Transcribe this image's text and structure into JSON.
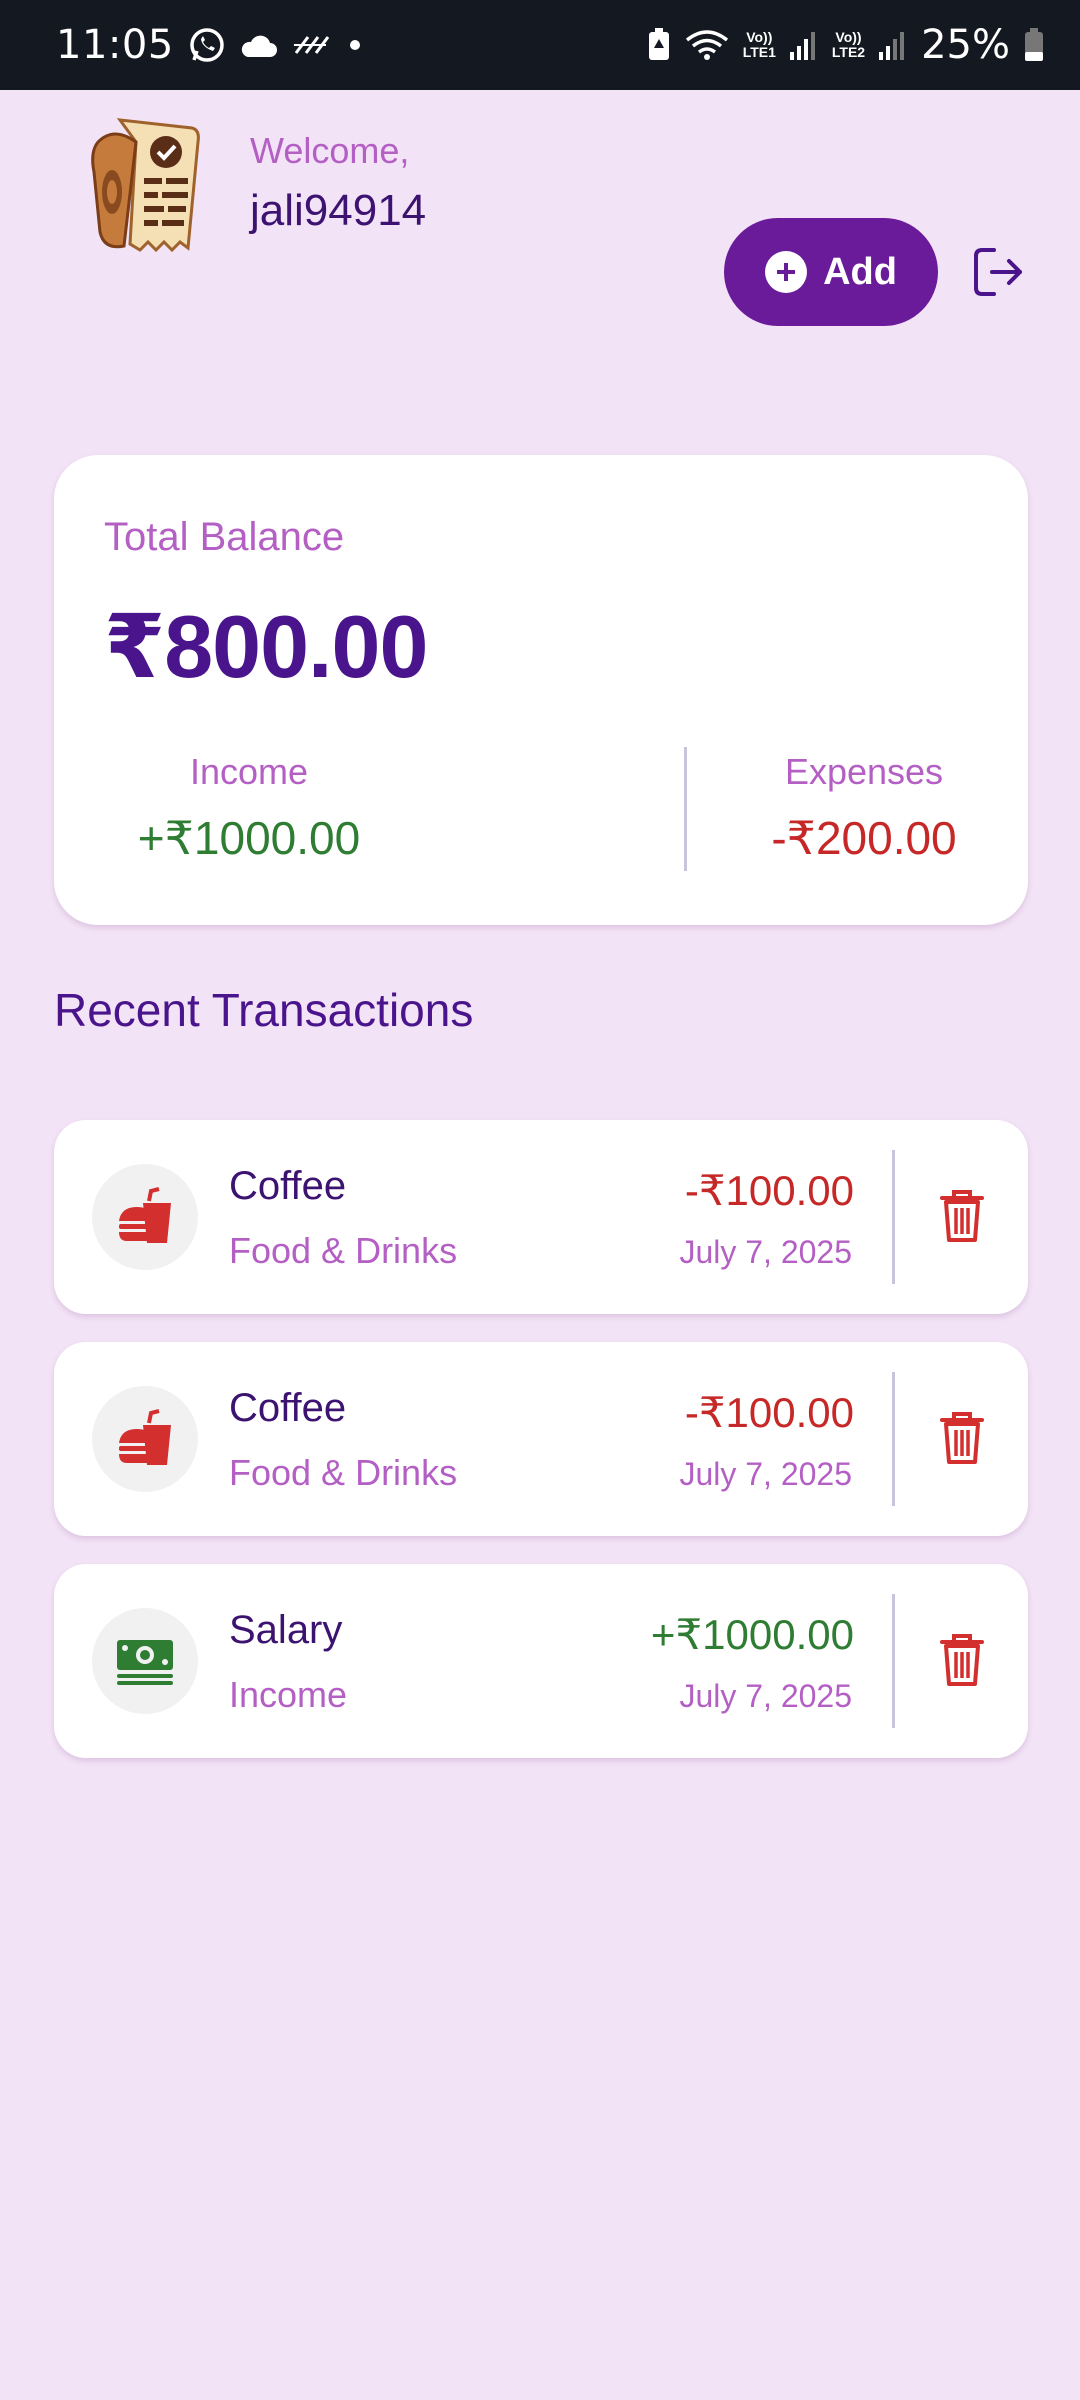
{
  "status_bar": {
    "time": "11:05",
    "battery_percent": "25%",
    "sim1_top": "Vo))",
    "sim1_bottom": "LTE1",
    "sim2_top": "Vo))",
    "sim2_bottom": "LTE2",
    "icons": [
      "whatsapp-icon",
      "cloud-icon",
      "signal-hash-icon",
      "dot-icon",
      "battery-saver-icon",
      "wifi-icon",
      "cell-signal-icon",
      "cell-signal-icon",
      "battery-icon"
    ]
  },
  "header": {
    "welcome": "Welcome,",
    "username": "jali94914",
    "add_label": "Add",
    "logo_icon": "receipt-logo-icon",
    "logout_icon": "logout-icon"
  },
  "balance": {
    "label": "Total Balance",
    "amount": "₹800.00",
    "income_label": "Income",
    "income_amount": "+₹1000.00",
    "expenses_label": "Expenses",
    "expenses_amount": "-₹200.00"
  },
  "section": {
    "title": "Recent Transactions"
  },
  "transactions": [
    {
      "title": "Coffee",
      "category": "Food & Drinks",
      "amount": "-₹100.00",
      "date": "July 7, 2025",
      "type": "expense",
      "icon": "food-drink-icon"
    },
    {
      "title": "Coffee",
      "category": "Food & Drinks",
      "amount": "-₹100.00",
      "date": "July 7, 2025",
      "type": "expense",
      "icon": "food-drink-icon"
    },
    {
      "title": "Salary",
      "category": "Income",
      "amount": "+₹1000.00",
      "date": "July 7, 2025",
      "type": "income",
      "icon": "money-icon"
    }
  ],
  "colors": {
    "background": "#f3e3f6",
    "primary": "#6a1b9a",
    "heading": "#4a148c",
    "accent_text": "#b45fc4",
    "income": "#2e7d32",
    "expense": "#c62828"
  }
}
